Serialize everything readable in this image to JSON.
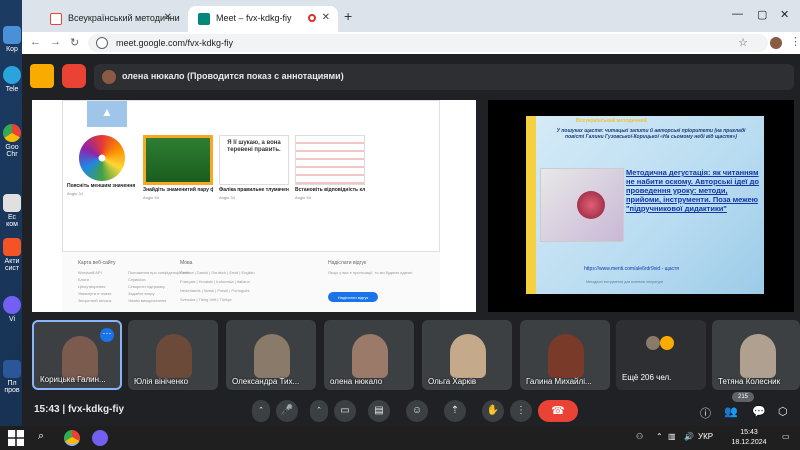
{
  "desktop": {
    "icons": [
      {
        "label": "Кор"
      },
      {
        "label": "Tele"
      },
      {
        "label": "Goo Chr"
      },
      {
        "label": "Ес ком"
      },
      {
        "label": "Акти сист"
      },
      {
        "label": "Vi"
      },
      {
        "label": "Пл пров"
      }
    ]
  },
  "browser": {
    "tabs": [
      {
        "label": "Всеукраїнський методичний"
      },
      {
        "label": "Meet – fvx-kdkg-fiy"
      }
    ],
    "url": "meet.google.com/fvx-kdkg-fiy"
  },
  "meet": {
    "presenting_label": "олена нюкало (Проводится показ с аннотациями)",
    "left_slide": {
      "cards": [
        {
          "title": "Поясніть меншим значення",
          "meta": "Anglo 34"
        },
        {
          "title": "Знайдіть знаменитий пару фр",
          "meta": "Anglo 34"
        },
        {
          "title": "Фаліка правильне тлумачення",
          "meta": "Anglo 34"
        },
        {
          "title": "Встановіть відповідність клітинками",
          "meta": "Anglo 34"
        }
      ],
      "card_thumb_texts": [
        "Я її шукаю, а вона теревені править."
      ],
      "footer": {
        "col1_title": "Карта веб-сайту",
        "col1_items": [
          "Wordwall API",
          "Блоги",
          "Ціноутворення",
          "Увімкнути в тимах",
          "Зворотний зв'язок"
        ],
        "col2_items": [
          "Положення про конфіденційність",
          "Сервісіси",
          "Створити підтримку",
          "Задайте вгору",
          "Умови використання"
        ],
        "col3_title": "Мова",
        "col3_items": [
          "Čeština | Dansk | Deutsch | Eesti | English",
          "Français | Hrvatski | Indonesia | Italiano",
          "Nederlands | Norsk | Polski | Português",
          "Svenska | Tiếng Việt | Türkçe"
        ],
        "col4_title": "Надіслати відгук",
        "col4_text": "Якщо у вас є пропозиції, то ми будемо вдячні.",
        "feedback_button": "Надіслати відгук"
      }
    },
    "right_slide": {
      "top": "Всеукраїнський методичний",
      "subtitle": "У пошуках щастя: читацькі запити й авторські пріоритети (на прикладі повісті Галини Гузовської-Корицької «На сьомому небі від щастя»)",
      "title": "Методична дегустація: як читанням не набити оскому. Авторські ідеї до проведення уроку: методи, прийоми, інструменти. Поза межею \"підручникової дидактики\"",
      "link": "https://www.menti.com/ale6rdr9xid - щастя",
      "footer": "Методичні інструменти для вчителів літератури"
    },
    "participants": [
      {
        "name": "Корицька Галин...",
        "active": true,
        "color": "#7a5b4e"
      },
      {
        "name": "Юлія вініченко",
        "active": false,
        "color": "#6b4a3a"
      },
      {
        "name": "Олександра Тих...",
        "active": false,
        "color": "#8a7a6a"
      },
      {
        "name": "олена нюкало",
        "active": false,
        "color": "#9b7a6a"
      },
      {
        "name": "Ольга Харків",
        "active": false,
        "color": "#c4a98a"
      },
      {
        "name": "Галина Михайлі...",
        "active": false,
        "color": "#7a3a2a"
      }
    ],
    "others_label": "Ещё 206 чел.",
    "last_tile_name": "Тетяна Колесник",
    "meeting_time": "15:43",
    "meeting_code": "fvx-kdkg-fiy",
    "participants_count": "215"
  },
  "taskbar": {
    "lang": "УКР",
    "time": "15:43",
    "date": "18.12.2024"
  },
  "colors": {
    "meet_bg": "#202124",
    "end_call": "#ea4335",
    "accent": "#1a73e8"
  }
}
